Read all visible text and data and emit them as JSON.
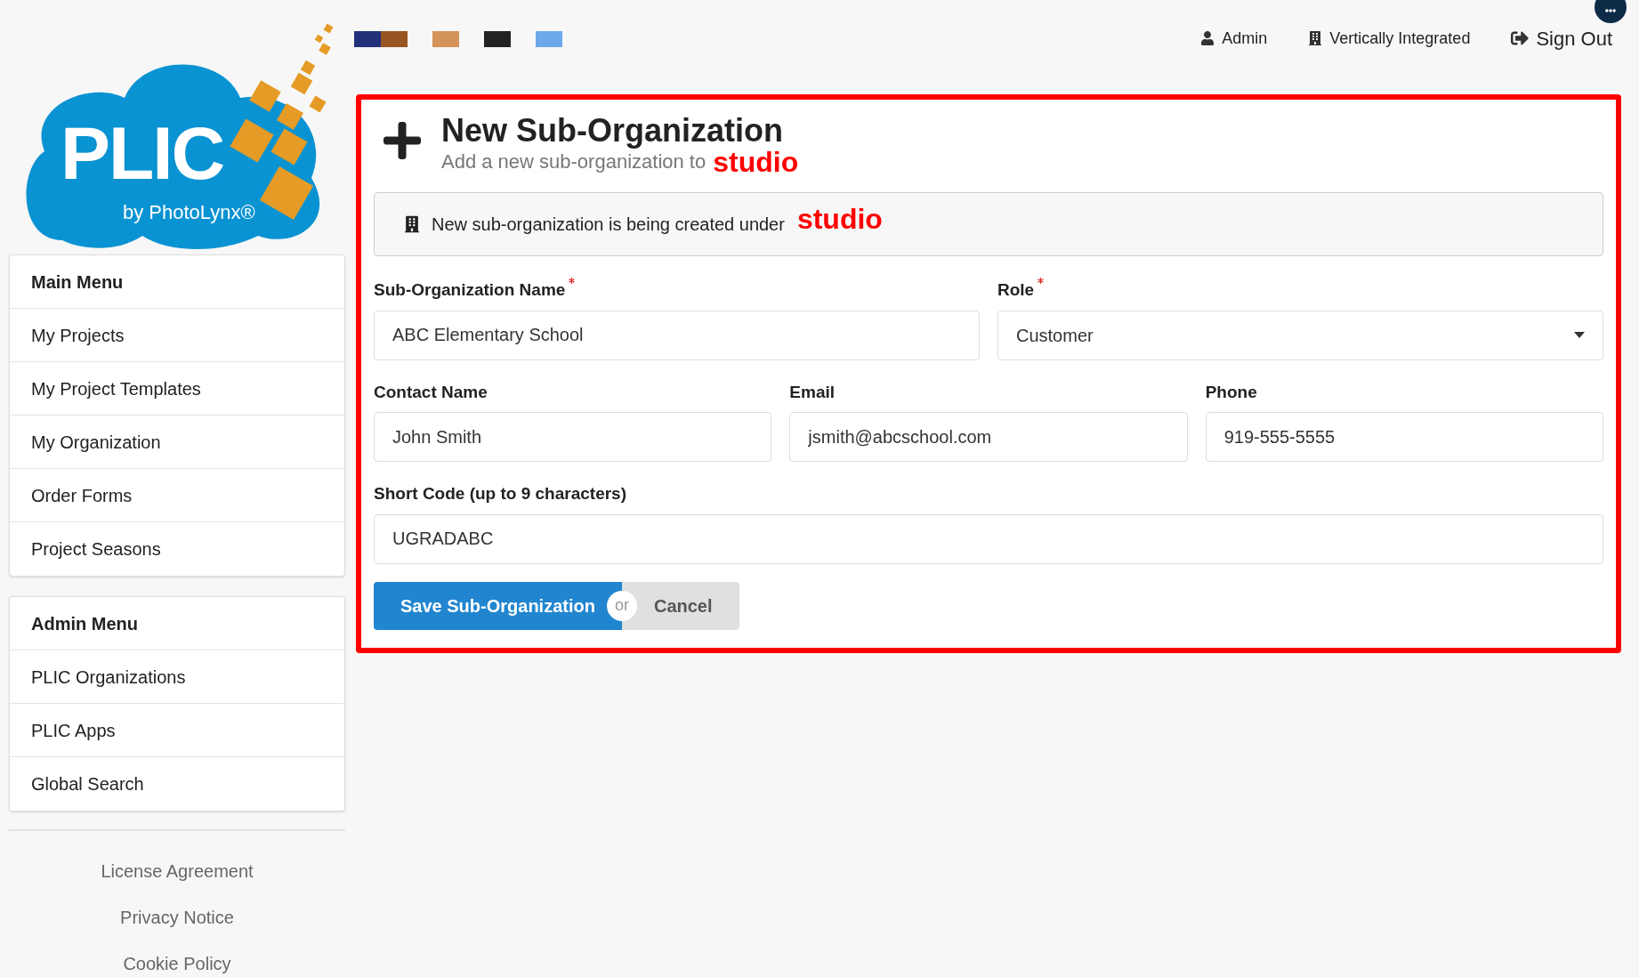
{
  "swatches": [
    {
      "items": [
        {
          "color": "#22307a"
        },
        {
          "color": "#975522"
        }
      ]
    },
    {
      "items": [
        {
          "color": "#d39359"
        }
      ]
    },
    {
      "items": [
        {
          "color": "#222222"
        }
      ]
    },
    {
      "items": [
        {
          "color": "#6ca8ea"
        }
      ]
    }
  ],
  "logo": {
    "title": "PLIC",
    "byline": "by PhotoLynx®"
  },
  "top_nav": [
    {
      "kind": "user",
      "label": "Admin"
    },
    {
      "kind": "org",
      "label": "Vertically Integrated"
    },
    {
      "kind": "signout",
      "label": "Sign Out"
    }
  ],
  "menus": [
    {
      "title": "Main Menu",
      "items": [
        "My Projects",
        "My Project Templates",
        "My Organization",
        "Order Forms",
        "Project Seasons"
      ]
    },
    {
      "title": "Admin Menu",
      "items": [
        "PLIC Organizations",
        "PLIC Apps",
        "Global Search"
      ]
    }
  ],
  "footer_links": [
    "License Agreement",
    "Privacy Notice",
    "Cookie Policy"
  ],
  "header": {
    "title": "New Sub-Organization",
    "subtitle": "Add a new sub-organization to",
    "subtitle_annotation": "studio"
  },
  "notice": {
    "text": "New sub-organization is being created under",
    "annotation": "studio"
  },
  "form_rows": [
    [
      {
        "kind": "text",
        "label": "Sub-Organization Name",
        "required": true,
        "value": "ABC Elementary School"
      },
      {
        "kind": "select",
        "label": "Role",
        "required": true,
        "value": "Customer"
      }
    ],
    [
      {
        "kind": "text",
        "label": "Contact Name",
        "required": false,
        "value": "John Smith"
      },
      {
        "kind": "text",
        "label": "Email",
        "required": false,
        "value": "jsmith@abcschool.com"
      },
      {
        "kind": "text",
        "label": "Phone",
        "required": false,
        "value": "919-555-5555"
      }
    ],
    [
      {
        "kind": "text",
        "label": "Short Code (up to 9 characters)",
        "required": false,
        "value": "UGRADABC"
      }
    ]
  ],
  "actions": {
    "save": "Save Sub-Organization",
    "separator": "or",
    "cancel": "Cancel"
  }
}
